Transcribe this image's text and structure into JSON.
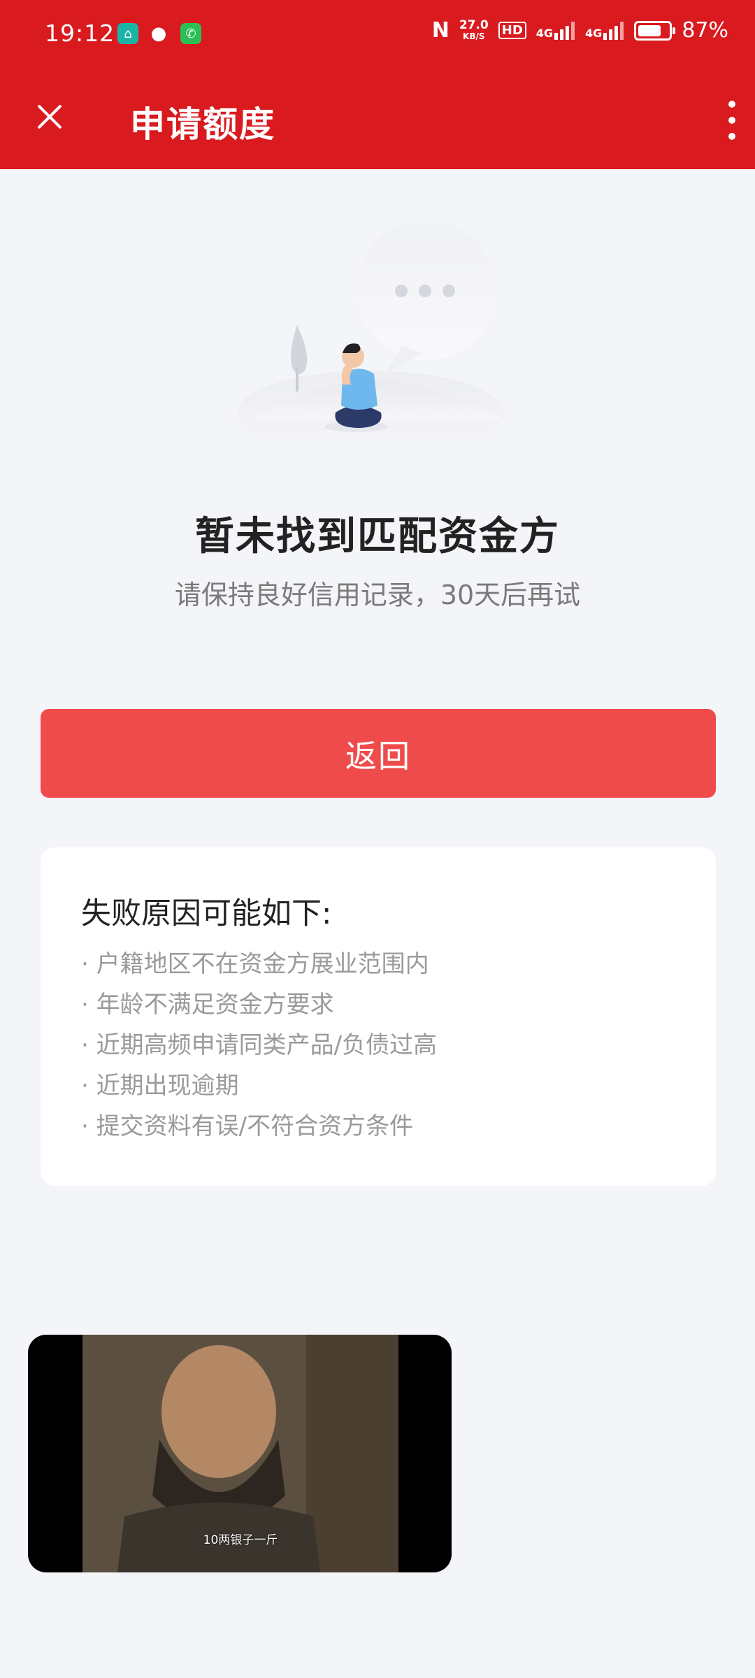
{
  "status_bar": {
    "time": "19:12",
    "network_speed_value": "27.0",
    "network_speed_unit": "KB/S",
    "hd_label": "HD",
    "signal_label_1": "4G",
    "signal_label_2": "4G",
    "battery_percent": "87%",
    "battery_level": 0.87
  },
  "toolbar": {
    "title": "申请额度"
  },
  "result": {
    "title": "暂未找到匹配资金方",
    "subtitle": "请保持良好信用记录，30天后再试"
  },
  "back_button": {
    "label": "返回"
  },
  "reasons": {
    "title": "失败原因可能如下:",
    "items": [
      "· 户籍地区不在资金方展业范围内",
      "· 年龄不满足资金方要求",
      "· 近期高频申请同类产品/负债过高",
      "· 近期出现逾期",
      "· 提交资料有误/不符合资方条件"
    ]
  },
  "floating_video": {
    "caption": "10两银子一斤"
  },
  "colors": {
    "brand_red": "#d91a1f",
    "button_red": "#ef4b4b",
    "background": "#f4f5f9"
  }
}
